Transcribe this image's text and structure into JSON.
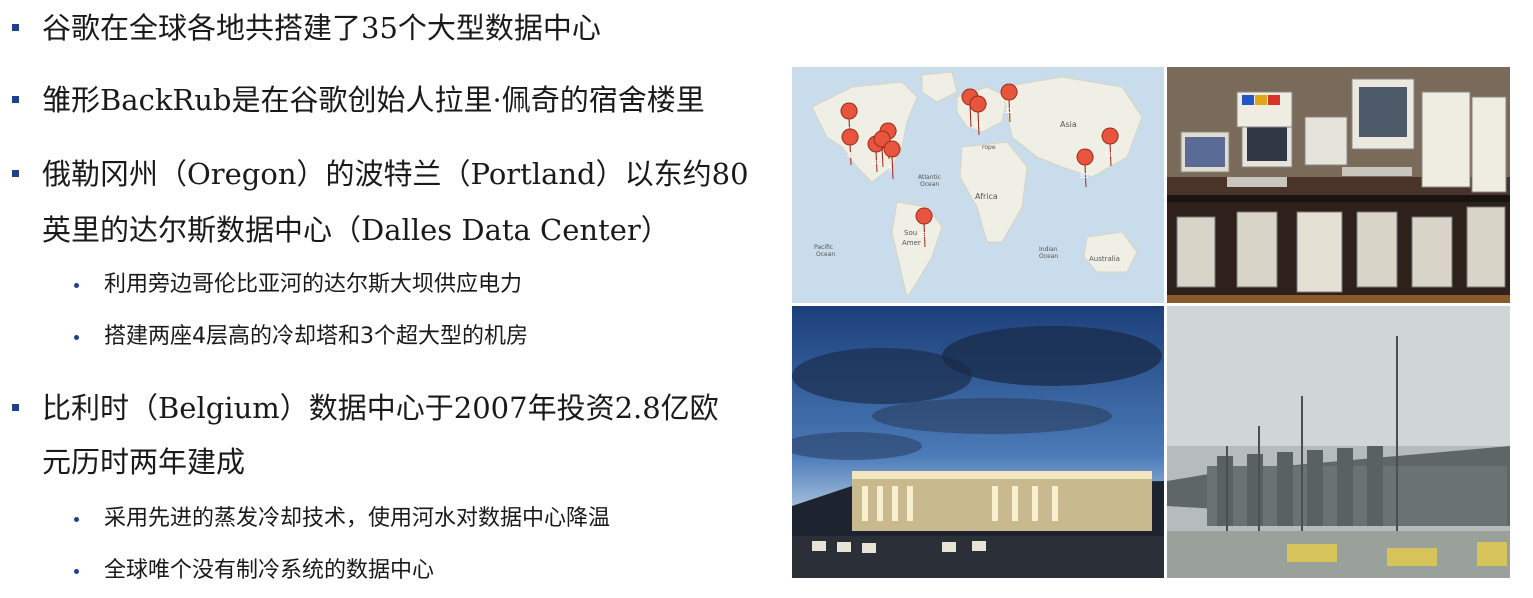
{
  "bullets": [
    {
      "level": 1,
      "text": "谷歌在全球各地共搭建了35个大型数据中心"
    },
    {
      "level": 1,
      "text": "雏形BackRub是在谷歌创始人拉里·佩奇的宿舍楼里"
    },
    {
      "level": 1,
      "text": "俄勒冈州（Oregon）的波特兰（Portland）以东约80",
      "text2": "英里的达尔斯数据中心（Dalles Data Center）"
    },
    {
      "level": 2,
      "text": "利用旁边哥伦比亚河的达尔斯大坝供应电力"
    },
    {
      "level": 2,
      "text": "搭建两座4层高的冷却塔和3个超大型的机房"
    },
    {
      "level": 1,
      "text": "比利时（Belgium）数据中心于2007年投资2.8亿欧",
      "text2": "元历时两年建成"
    },
    {
      "level": 2,
      "text": "采用先进的蒸发冷却技术，使用河水对数据中心降温"
    },
    {
      "level": 2,
      "text": "全球唯个没有制冷系统的数据中心"
    }
  ],
  "map": {
    "labels": {
      "asia": "Asia",
      "africa": "Africa",
      "atlantic": "Atlantic",
      "atlantic2": "Ocean",
      "europe": "rope",
      "south": "Sou",
      "amer": "Amer",
      "pacific": "Pacific",
      "pacific2": "Ocean",
      "indian": "Indian",
      "indian2": "Ocean",
      "australia": "Australia"
    },
    "markers": [
      "7",
      "4",
      "14",
      "5",
      "32",
      "31",
      "35",
      "34",
      "33"
    ]
  },
  "colors": {
    "accent": "#1f3f8f",
    "marker": "#e8553f"
  }
}
